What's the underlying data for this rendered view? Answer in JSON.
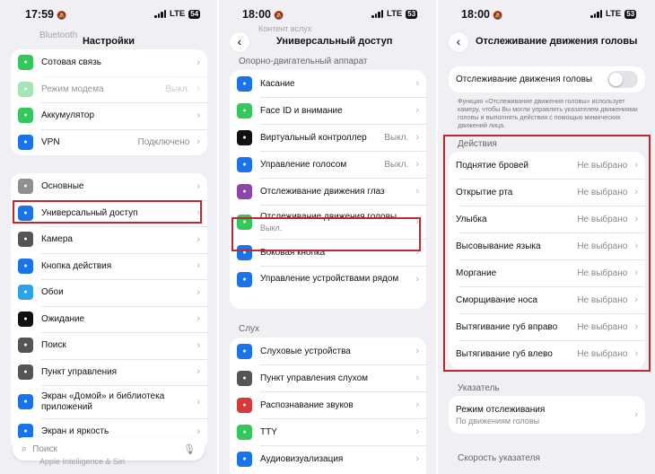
{
  "colors": {
    "accent": "#c0282d",
    "bg": "#f0f0f4"
  },
  "p1": {
    "time": "17:59",
    "lte": "LTE",
    "battery": "54",
    "title": "Настройки",
    "faded_top": "Bluetooth",
    "group1": [
      {
        "icon": "cellular-icon",
        "color": "#34c759",
        "label": "Сотовая связь",
        "value": ""
      },
      {
        "icon": "hotspot-icon",
        "color": "#34c759",
        "label": "Режим модема",
        "value": "Выкл.",
        "dim": true
      },
      {
        "icon": "battery-icon",
        "color": "#34c759",
        "label": "Аккумулятор",
        "value": ""
      },
      {
        "icon": "vpn-icon",
        "color": "#1a73e8",
        "label": "VPN",
        "value": "Подключено"
      }
    ],
    "group2": [
      {
        "icon": "gear-icon",
        "color": "#8e8e93",
        "label": "Основные"
      },
      {
        "icon": "accessibility-icon",
        "color": "#1a73e8",
        "label": "Универсальный доступ"
      },
      {
        "icon": "camera-icon",
        "color": "#555",
        "label": "Камера"
      },
      {
        "icon": "action-button-icon",
        "color": "#1a73e8",
        "label": "Кнопка действия"
      },
      {
        "icon": "wallpaper-icon",
        "color": "#2aa3e8",
        "label": "Обои"
      },
      {
        "icon": "standby-icon",
        "color": "#111",
        "label": "Ожидание"
      },
      {
        "icon": "search-icon",
        "color": "#555",
        "label": "Поиск"
      },
      {
        "icon": "control-center-icon",
        "color": "#555",
        "label": "Пункт управления"
      },
      {
        "icon": "home-screen-icon",
        "color": "#1a73e8",
        "label": "Экран «Домой» и библиотека приложений"
      },
      {
        "icon": "display-icon",
        "color": "#1a73e8",
        "label": "Экран и яркость"
      }
    ],
    "faded_bottom": "Apple Intelligence & Siri",
    "search_placeholder": "Поиск"
  },
  "p2": {
    "time": "18:00",
    "lte": "LTE",
    "battery": "53",
    "title": "Универсальный доступ",
    "faded_top": "Контент вслух",
    "section1": "Опорно-двигательный аппарат",
    "group1": [
      {
        "icon": "touch-icon",
        "color": "#1a73e8",
        "label": "Касание",
        "value": ""
      },
      {
        "icon": "faceid-icon",
        "color": "#34c759",
        "label": "Face ID и внимание",
        "value": ""
      },
      {
        "icon": "switch-control-icon",
        "color": "#111",
        "label": "Виртуальный контроллер",
        "value": "Выкл."
      },
      {
        "icon": "voice-control-icon",
        "color": "#1a73e8",
        "label": "Управление голосом",
        "value": "Выкл."
      },
      {
        "icon": "eye-tracking-icon",
        "color": "#8e44ad",
        "label": "Отслеживание движения глаз",
        "value": ""
      },
      {
        "icon": "head-tracking-icon",
        "color": "#34c759",
        "label": "Отслеживание движения головы",
        "sub": "Выкл.",
        "value": ""
      },
      {
        "icon": "side-button-icon",
        "color": "#1a73e8",
        "label": "Боковая кнопка",
        "value": ""
      },
      {
        "icon": "nearby-devices-icon",
        "color": "#1a73e8",
        "label": "Управление устройствами рядом",
        "value": ""
      }
    ],
    "section2": "Слух",
    "group2": [
      {
        "icon": "hearing-devices-icon",
        "color": "#1a73e8",
        "label": "Слуховые устройства"
      },
      {
        "icon": "hearing-control-icon",
        "color": "#555",
        "label": "Пункт управления слухом"
      },
      {
        "icon": "sound-recognition-icon",
        "color": "#d63a3a",
        "label": "Распознавание звуков"
      },
      {
        "icon": "tty-icon",
        "color": "#34c759",
        "label": "TTY"
      },
      {
        "icon": "audio-visual-icon",
        "color": "#1a73e8",
        "label": "Аудиовизуализация"
      }
    ]
  },
  "p3": {
    "time": "18:00",
    "lte": "LTE",
    "battery": "53",
    "title": "Отслеживание движения головы",
    "toggle_label": "Отслеживание движения головы",
    "note": "Функция «Отслеживание движения головы» использует камеру, чтобы Вы могли управлять указателем движениями головы и выполнять действия с помощью мимических движений лица.",
    "actions_header": "Действия",
    "actions": [
      {
        "label": "Поднятие бровей",
        "value": "Не выбрано"
      },
      {
        "label": "Открытие рта",
        "value": "Не выбрано"
      },
      {
        "label": "Улыбка",
        "value": "Не выбрано"
      },
      {
        "label": "Высовывание языка",
        "value": "Не выбрано"
      },
      {
        "label": "Моргание",
        "value": "Не выбрано"
      },
      {
        "label": "Сморщивание носа",
        "value": "Не выбрано"
      },
      {
        "label": "Вытягивание губ вправо",
        "value": "Не выбрано"
      },
      {
        "label": "Вытягивание губ влево",
        "value": "Не выбрано"
      }
    ],
    "pointer_header": "Указатель",
    "tracking_mode": "Режим отслеживания",
    "tracking_mode_value": "По движениям головы",
    "speed_header": "Скорость указателя"
  }
}
